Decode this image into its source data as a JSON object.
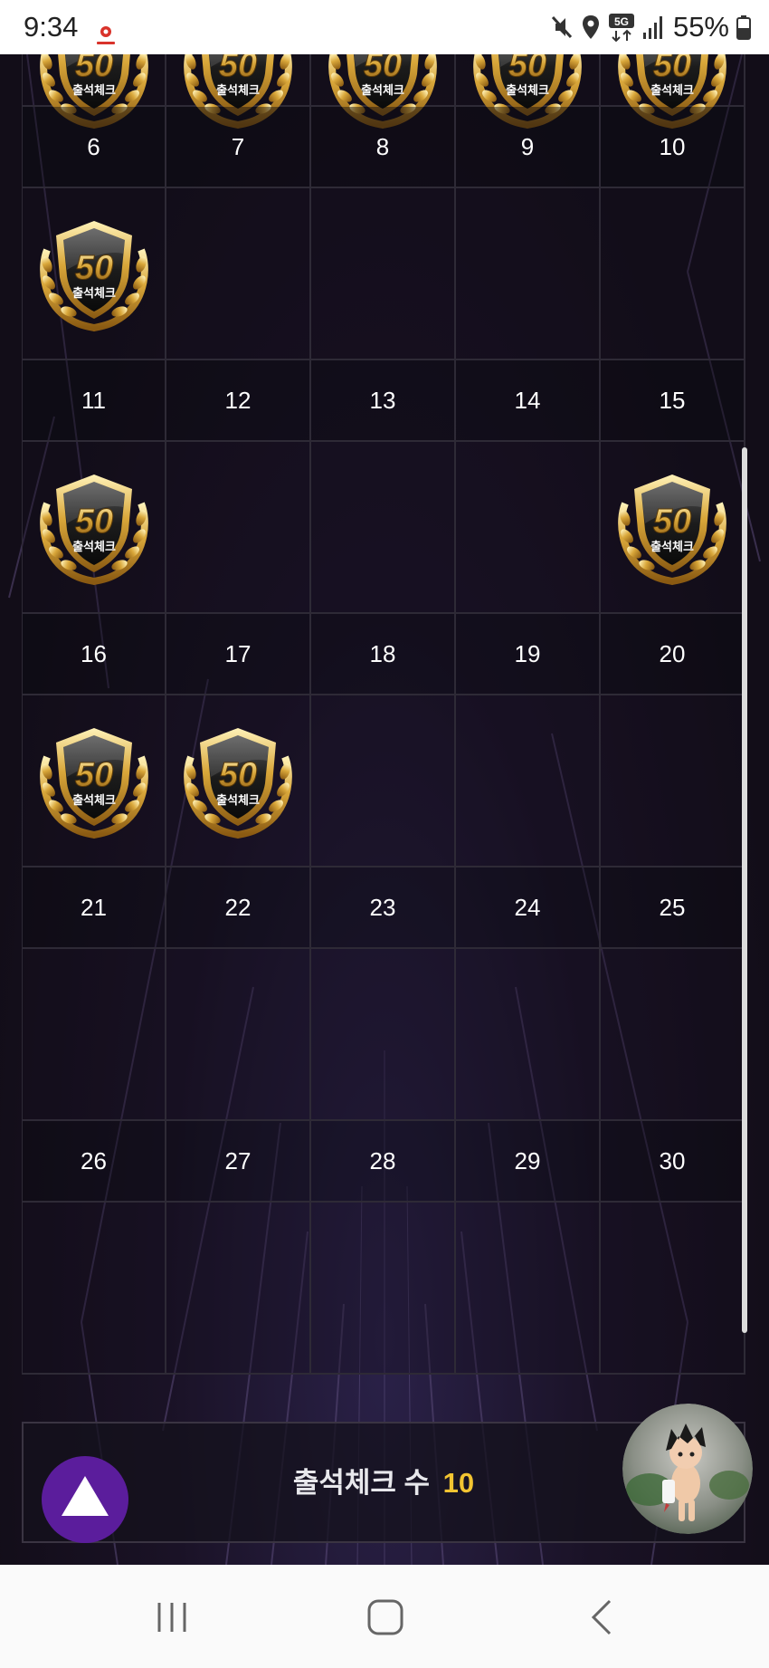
{
  "status_bar": {
    "time": "9:34",
    "network": "5G",
    "battery": "55%",
    "icons": [
      "app-notification-icon",
      "mute-icon",
      "location-icon",
      "5g-icon",
      "signal-icon",
      "battery-icon"
    ]
  },
  "calendar": {
    "weeks": [
      {
        "dates": [
          "",
          "",
          "",
          "",
          ""
        ],
        "stamped": [
          true,
          true,
          true,
          true,
          true
        ]
      },
      {
        "dates": [
          "6",
          "7",
          "8",
          "9",
          "10"
        ],
        "stamped": [
          true,
          false,
          false,
          false,
          false
        ]
      },
      {
        "dates": [
          "11",
          "12",
          "13",
          "14",
          "15"
        ],
        "stamped": [
          true,
          false,
          false,
          false,
          true
        ]
      },
      {
        "dates": [
          "16",
          "17",
          "18",
          "19",
          "20"
        ],
        "stamped": [
          true,
          true,
          false,
          false,
          false
        ]
      },
      {
        "dates": [
          "21",
          "22",
          "23",
          "24",
          "25"
        ],
        "stamped": [
          false,
          false,
          false,
          false,
          false
        ]
      },
      {
        "dates": [
          "26",
          "27",
          "28",
          "29",
          "30"
        ],
        "stamped": [
          false,
          false,
          false,
          false,
          false
        ]
      }
    ],
    "badge": {
      "number": "50",
      "label": "출석체크",
      "icon": "attendance-badge-icon"
    }
  },
  "footer": {
    "count_label": "출석체크 수",
    "count_value": "10"
  },
  "buttons": {
    "scroll_top_icon": "triangle-up-icon",
    "avatar_icon": "character-avatar-icon"
  },
  "nav_bar": {
    "recent_icon": "recent-apps-icon",
    "home_icon": "home-icon",
    "back_icon": "back-icon"
  },
  "colors": {
    "accent_gold": "#f2c431",
    "scroll_button": "#5b1d9c",
    "background": "#120d18"
  }
}
